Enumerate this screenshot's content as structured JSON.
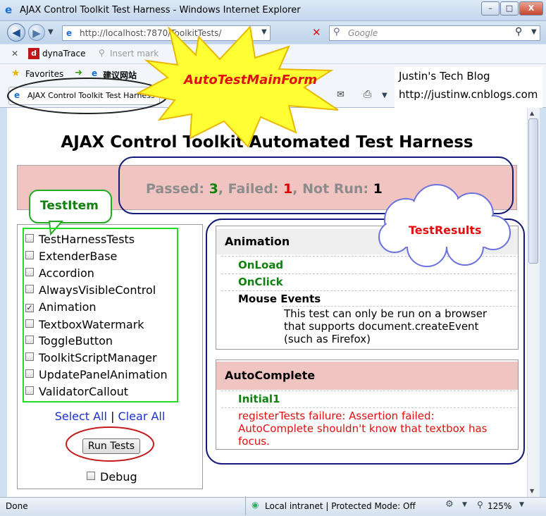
{
  "window": {
    "title": "AJAX Control Toolkit Test Harness - Windows Internet Explorer",
    "minimize": "–",
    "maximize": "□",
    "close": "X"
  },
  "nav": {
    "url": "http://localhost:7870/ToolkitTests/",
    "search_placeholder": "Google"
  },
  "toolbar": {
    "dynatrace": "dynaTrace",
    "insert_mark": "Insert mark",
    "favorites": "Favorites",
    "suggested": "建议网站",
    "tab_title": "AJAX Control Toolkit Test Harness"
  },
  "blog": {
    "name": "Justin's Tech Blog",
    "url": "http://justinw.cnblogs.com"
  },
  "page": {
    "heading": "AJAX Control Toolkit Automated Test Harness",
    "summary": {
      "passed_label": "Passed: ",
      "passed": "3",
      "failed_label": ", Failed: ",
      "failed": "1",
      "notrun_label": ", Not Run: ",
      "notrun": "1"
    },
    "tests": [
      {
        "label": "TestHarnessTests",
        "checked": false
      },
      {
        "label": "ExtenderBase",
        "checked": false
      },
      {
        "label": "Accordion",
        "checked": false
      },
      {
        "label": "AlwaysVisibleControl",
        "checked": false
      },
      {
        "label": "Animation",
        "checked": true
      },
      {
        "label": "TextboxWatermark",
        "checked": false
      },
      {
        "label": "ToggleButton",
        "checked": false
      },
      {
        "label": "ToolkitScriptManager",
        "checked": false
      },
      {
        "label": "UpdatePanelAnimation",
        "checked": false
      },
      {
        "label": "ValidatorCallout",
        "checked": false
      }
    ],
    "select_all": "Select All",
    "separator": "|",
    "clear_all": "Clear All",
    "run_tests": "Run Tests",
    "debug": "Debug",
    "results": [
      {
        "suite": "Animation",
        "tests": [
          "OnLoad",
          "OnClick"
        ],
        "notrun_name": "Mouse Events",
        "notrun_note": [
          "This test can only be run on a browser",
          "that supports document.createEvent",
          "(such as Firefox)"
        ]
      },
      {
        "suite": "AutoComplete",
        "tests": [
          "Initial1"
        ],
        "error": [
          "registerTests failure: Assertion failed:",
          "AutoComplete shouldn't know that textbox has",
          "focus."
        ]
      }
    ]
  },
  "status": {
    "left": "Done",
    "zone": "Local intranet | Protected Mode: Off",
    "zoom": "125%"
  },
  "annotations": {
    "main_form": "AutoTestMainForm",
    "test_item": "TestItem",
    "test_results": "TestResults"
  },
  "colors": {
    "passed": "#108010",
    "failed": "#e00000",
    "failed_header": "#f0c4c0",
    "annotation_red": "#e01010",
    "annotation_green": "#108010"
  }
}
